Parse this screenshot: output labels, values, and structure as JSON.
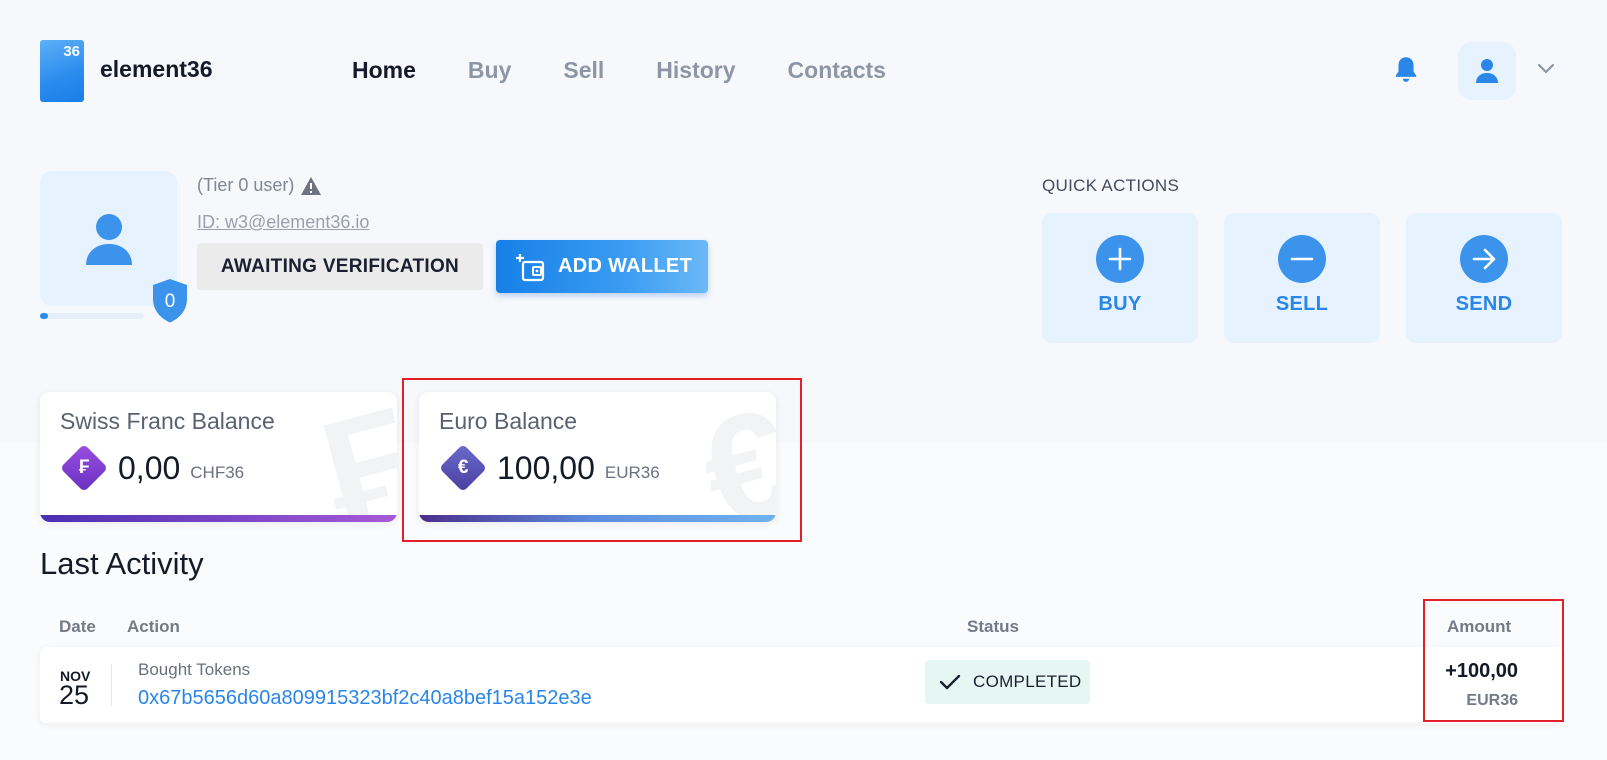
{
  "app": {
    "logo_badge": "36",
    "logo_text": "element36"
  },
  "nav": {
    "links": [
      "Home",
      "Buy",
      "Sell",
      "History",
      "Contacts"
    ],
    "active": "Home"
  },
  "profile": {
    "tier_text": "(Tier 0 user)",
    "tier_level": "0",
    "id_text": "ID: w3@element36.io",
    "status_label": "AWAITING VERIFICATION",
    "add_wallet_label": "ADD WALLET",
    "progress_fraction": 0.08
  },
  "quick_actions": {
    "title": "QUICK ACTIONS",
    "items": [
      {
        "label": "BUY",
        "icon": "plus-icon"
      },
      {
        "label": "SELL",
        "icon": "minus-icon"
      },
      {
        "label": "SEND",
        "icon": "arrow-right-icon"
      }
    ]
  },
  "balances": [
    {
      "title": "Swiss Franc Balance",
      "amount": "0,00",
      "unit": "CHF36",
      "symbol": "₣",
      "icon_color": "#7a3fd0"
    },
    {
      "title": "Euro Balance",
      "amount": "100,00",
      "unit": "EUR36",
      "symbol": "€",
      "icon_color": "#5a56b8"
    }
  ],
  "activity": {
    "title": "Last Activity",
    "headers": {
      "date": "Date",
      "action": "Action",
      "status": "Status",
      "amount": "Amount"
    },
    "rows": [
      {
        "month": "NOV",
        "day": "25",
        "action": "Bought Tokens",
        "hash": "0x67b5656d60a809915323bf2c40a8bef15a152e3e",
        "status": "COMPLETED",
        "amount": "+100,00",
        "unit": "EUR36"
      }
    ]
  },
  "colors": {
    "accent": "#2a86e8",
    "highlight": "#e0202a"
  }
}
